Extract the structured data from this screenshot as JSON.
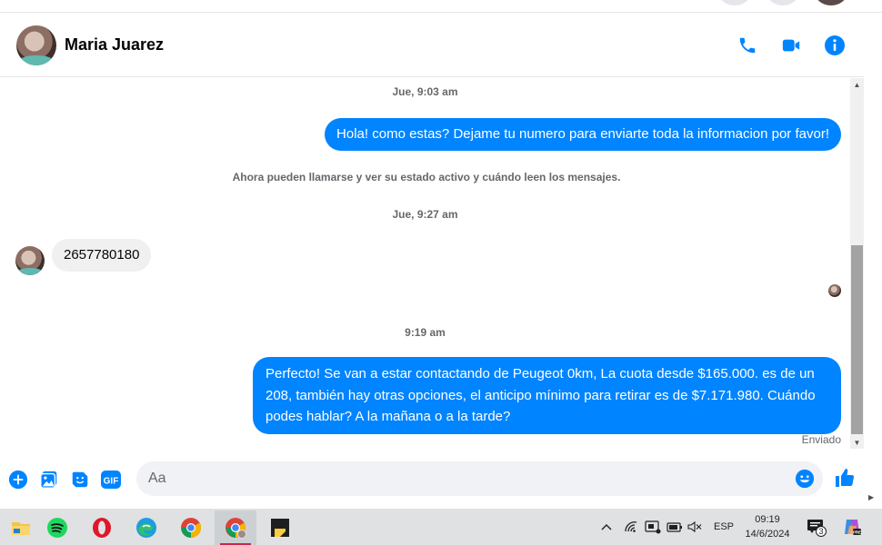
{
  "header": {
    "contact_name": "Maria Juarez",
    "actions": [
      {
        "name": "phone-icon",
        "label": "Call"
      },
      {
        "name": "video-icon",
        "label": "Video call"
      },
      {
        "name": "info-icon",
        "label": "Conversation information"
      }
    ]
  },
  "messages": {
    "timestamp_1": "Jue, 9:03 am",
    "outgoing_1": "Hola! como estas? Dejame tu numero para enviarte toda la informacion por favor!",
    "system_note": "Ahora pueden llamarse y ver su estado activo y cuándo leen los mensajes.",
    "timestamp_2": "Jue, 9:27 am",
    "incoming_1": "2657780180",
    "timestamp_3": "9:19 am",
    "outgoing_2": "Perfecto!  Se van a estar contactando de Peugeot 0km, La cuota desde $165.000. es de un 208, también hay otras opciones, el anticipo mínimo para retirar es de $7.171.980. Cuándo podes hablar? A la mañana o a la tarde?",
    "sent_status": "Enviado"
  },
  "composer": {
    "placeholder": "Aa",
    "gif_label": "GIF"
  },
  "taskbar": {
    "apps": [
      "file-explorer-icon",
      "spotify-icon",
      "opera-icon",
      "edge-icon",
      "chrome-icon",
      "chrome-profile-icon",
      "sticky-notes-icon"
    ],
    "language": "ESP",
    "time": "09:19",
    "date": "14/6/2024",
    "notification_count": "3"
  },
  "colors": {
    "accent": "#0084ff",
    "incoming_bubble": "#f0f0f0",
    "composer_bg": "#f0f2f5",
    "taskbar_bg": "#dfe1e3"
  }
}
